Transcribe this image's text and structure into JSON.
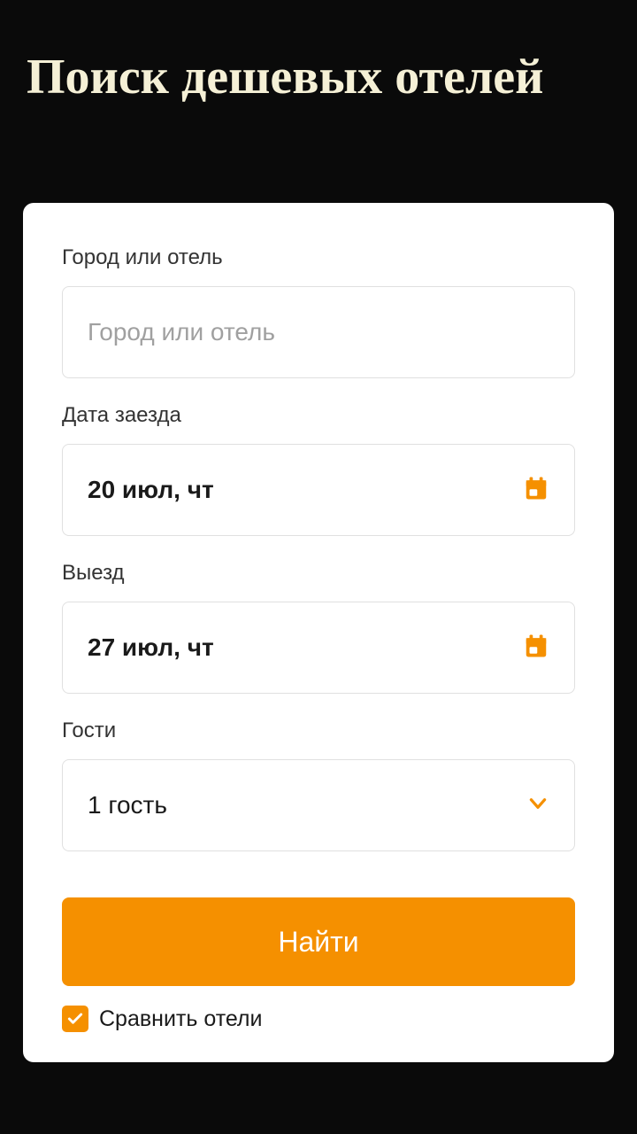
{
  "title": "Поиск дешевых отелей",
  "form": {
    "city": {
      "label": "Город или отель",
      "placeholder": "Город или отель",
      "value": ""
    },
    "checkin": {
      "label": "Дата заезда",
      "value": "20 июл, чт"
    },
    "checkout": {
      "label": "Выезд",
      "value": "27 июл, чт"
    },
    "guests": {
      "label": "Гости",
      "value": "1 гость"
    },
    "submit_label": "Найти",
    "compare_label": "Сравнить отели",
    "compare_checked": true
  },
  "colors": {
    "accent": "#f59000",
    "title": "#f5f0d6"
  }
}
